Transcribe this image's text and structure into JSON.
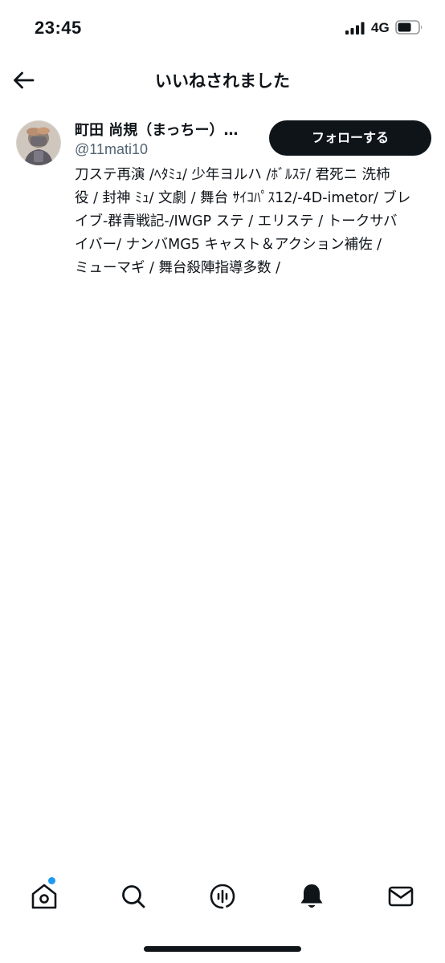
{
  "status_bar": {
    "time": "23:45",
    "network": "4G",
    "icons": [
      "signal-bars-icon",
      "battery-icon"
    ]
  },
  "header": {
    "title": "いいねされました",
    "back_icon": "arrow-left-icon"
  },
  "user": {
    "display_name": "町田 尚規（まっちー）…",
    "handle": "@11mati10",
    "follow_label": "フォローする",
    "bio_lines": [
      "刀ステ再演 /ﾍﾀﾐｭ/ 少年ヨルハ /ﾎﾞﾙｽﾃ/ 君死ニ 洗柿",
      "役 / 封神 ﾐｭ/ 文劇 / 舞台 ｻｲｺﾊﾟｽ12/-4D-imetor/ ブレ",
      "イブ-群青戦記-/IWGP ステ / エリステ / トークサバ",
      "イバー/ ナンバMG5 キャスト＆アクション補佐 /",
      "ミューマギ / 舞台殺陣指導多数 /"
    ]
  },
  "tab_bar": {
    "tabs": [
      "home-icon",
      "search-icon",
      "spaces-icon",
      "notifications-icon",
      "messages-icon"
    ],
    "active": "notifications-icon",
    "accent": "#1d9bf0"
  },
  "colors": {
    "text": "#0f1419",
    "secondary": "#536471",
    "button_bg": "#0f1419",
    "background": "#ffffff"
  }
}
